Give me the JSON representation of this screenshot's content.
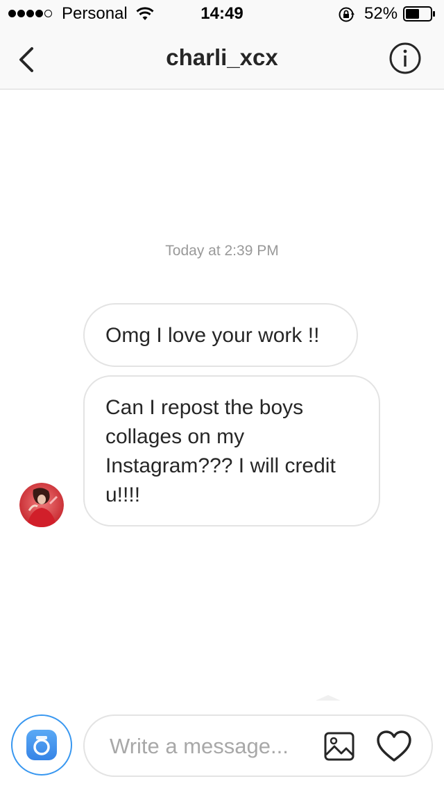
{
  "status_bar": {
    "carrier": "Personal",
    "time": "14:49",
    "battery": "52%",
    "icons": [
      "signal-dots",
      "wifi-icon",
      "orientation-lock-icon",
      "battery-icon"
    ]
  },
  "header": {
    "title": "charli_xcx",
    "back_icon": "chevron-left-icon",
    "info_icon": "info-icon"
  },
  "conversation": {
    "timestamp": "Today at 2:39 PM",
    "messages": [
      {
        "text": "Omg I love your work !!"
      },
      {
        "text": "Can I repost the boys collages on my Instagram??? I will credit u!!!!"
      }
    ]
  },
  "composer": {
    "placeholder": "Write a message...",
    "icons": [
      "camera-icon",
      "gallery-icon",
      "heart-icon"
    ]
  },
  "colors": {
    "accent": "#3897f0",
    "bubble_border": "#e3e3e3",
    "text": "#262626",
    "muted": "#999999"
  }
}
